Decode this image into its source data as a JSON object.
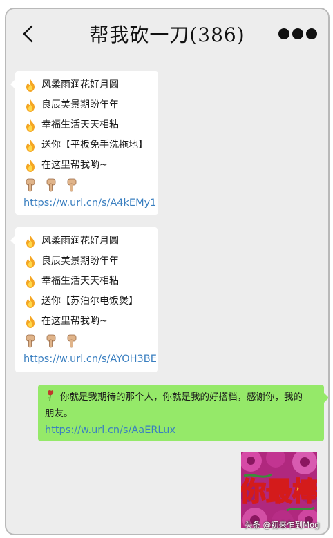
{
  "header": {
    "title": "帮我砍一刀(386)"
  },
  "messages": [
    {
      "lines": [
        "风柔雨润花好月圆",
        "良辰美景期盼年年",
        "幸福生活天天相粘",
        "送你【平板免手洗拖地】",
        "在这里帮我哟~"
      ],
      "link": "https://w.url.cn/s/A4kEMy1"
    },
    {
      "lines": [
        "风柔雨润花好月圆",
        "良辰美景期盼年年",
        "幸福生活天天相粘",
        "送你【苏泊尔电饭煲】",
        "在这里帮我哟~"
      ],
      "link": "https://w.url.cn/s/AYOH3BE"
    }
  ],
  "my_message": {
    "text_line1": "你就是我期待的那个人，你就是我的好搭档，感谢你，我的",
    "text_line2": "朋友。",
    "link": "https://w.url.cn/s/AaERLux"
  },
  "sticker": {
    "text": "你最棒"
  },
  "watermark": "头条 @初来乍到Mog",
  "icons": {
    "back": "back-arrow-icon",
    "more": "more-dots-icon",
    "fire": "fire-emoji-icon",
    "hand": "pointing-down-hand-icon",
    "rose": "wilted-rose-icon"
  },
  "colors": {
    "chat_background": "#ededed",
    "incoming_bubble": "#ffffff",
    "outgoing_bubble": "#95e969",
    "link": "#3a7fc0"
  }
}
